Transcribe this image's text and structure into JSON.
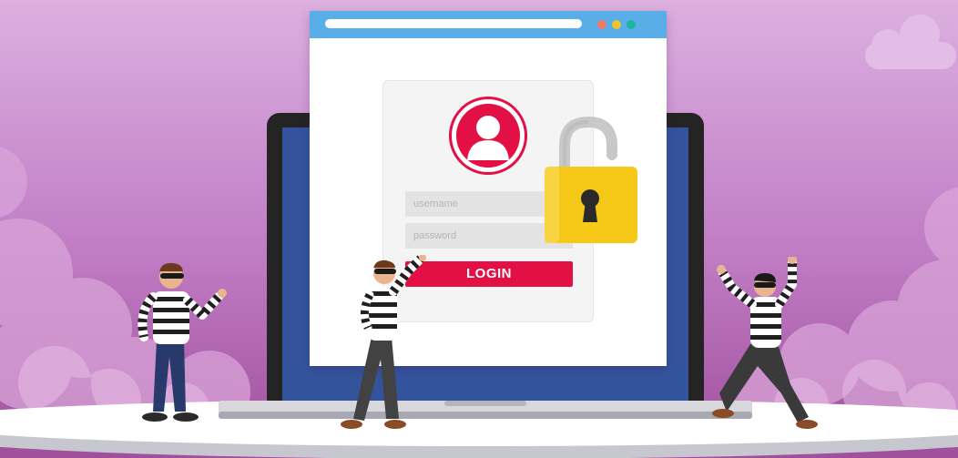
{
  "login_form": {
    "username_placeholder": "username",
    "password_placeholder": "password",
    "login_label": "LOGIN"
  },
  "icons": {
    "avatar": "user-icon",
    "lock": "padlock-icon",
    "cloud": "cloud-icon"
  },
  "colors": {
    "background_top": "#d9a9dd",
    "background_bottom": "#a3529f",
    "accent_red": "#e31046",
    "titlebar_blue": "#5aaee8",
    "laptop_screen": "#2e4f96",
    "padlock_gold": "#f6c817",
    "window_dots": [
      "#f07a6a",
      "#f3c230",
      "#1fb4a0"
    ]
  }
}
